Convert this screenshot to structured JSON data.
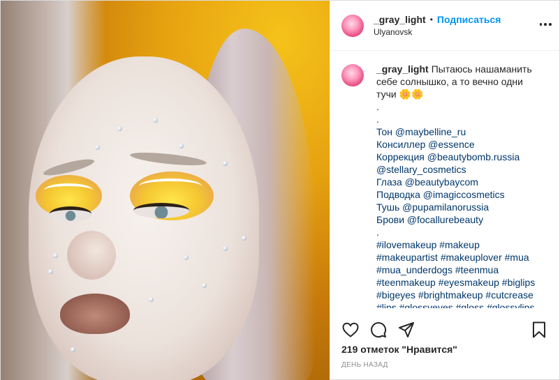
{
  "post": {
    "author": {
      "username": "_gray_light",
      "follow_label": "Подписаться",
      "separator": "•",
      "location": "Ulyanovsk"
    },
    "caption": {
      "username": "_gray_light",
      "text_lines": [
        "Пытаюсь нашаманить",
        "себе солнышко, а то вечно одни",
        "тучи 🌼🌼",
        ".",
        ".",
        "Тон @maybelline_ru",
        "Консиллер @essence",
        "Коррекция @beautybomb.russia",
        "@stellary_cosmetics",
        "Глаза @beautybaycom",
        "Подводка @imagiccosmetics",
        "Тушь @pupamilanorussia",
        "Брови @focallurebeauty",
        ".",
        "#ilovemakeup #makeup",
        "#makeupartist #makeuplover #mua",
        "#mua_underdogs #teenmua",
        "#teenmakeup #eyesmakeup #biglips",
        "#bigeyes #brightmakeup #cutcrease",
        "#lips #glossyeyes #gloss #glossylips"
      ]
    },
    "actions": {
      "like_icon": "heart-icon",
      "comment_icon": "comment-icon",
      "share_icon": "paper-plane-icon",
      "save_icon": "bookmark-icon"
    },
    "likes_text": "219 отметок \"Нравится\"",
    "timestamp": "День назад",
    "photo_description_icon": "photo"
  },
  "colors": {
    "link_blue": "#0095f6",
    "hashtag": "#00376b",
    "text": "#262626",
    "muted": "#8e8e8e"
  }
}
